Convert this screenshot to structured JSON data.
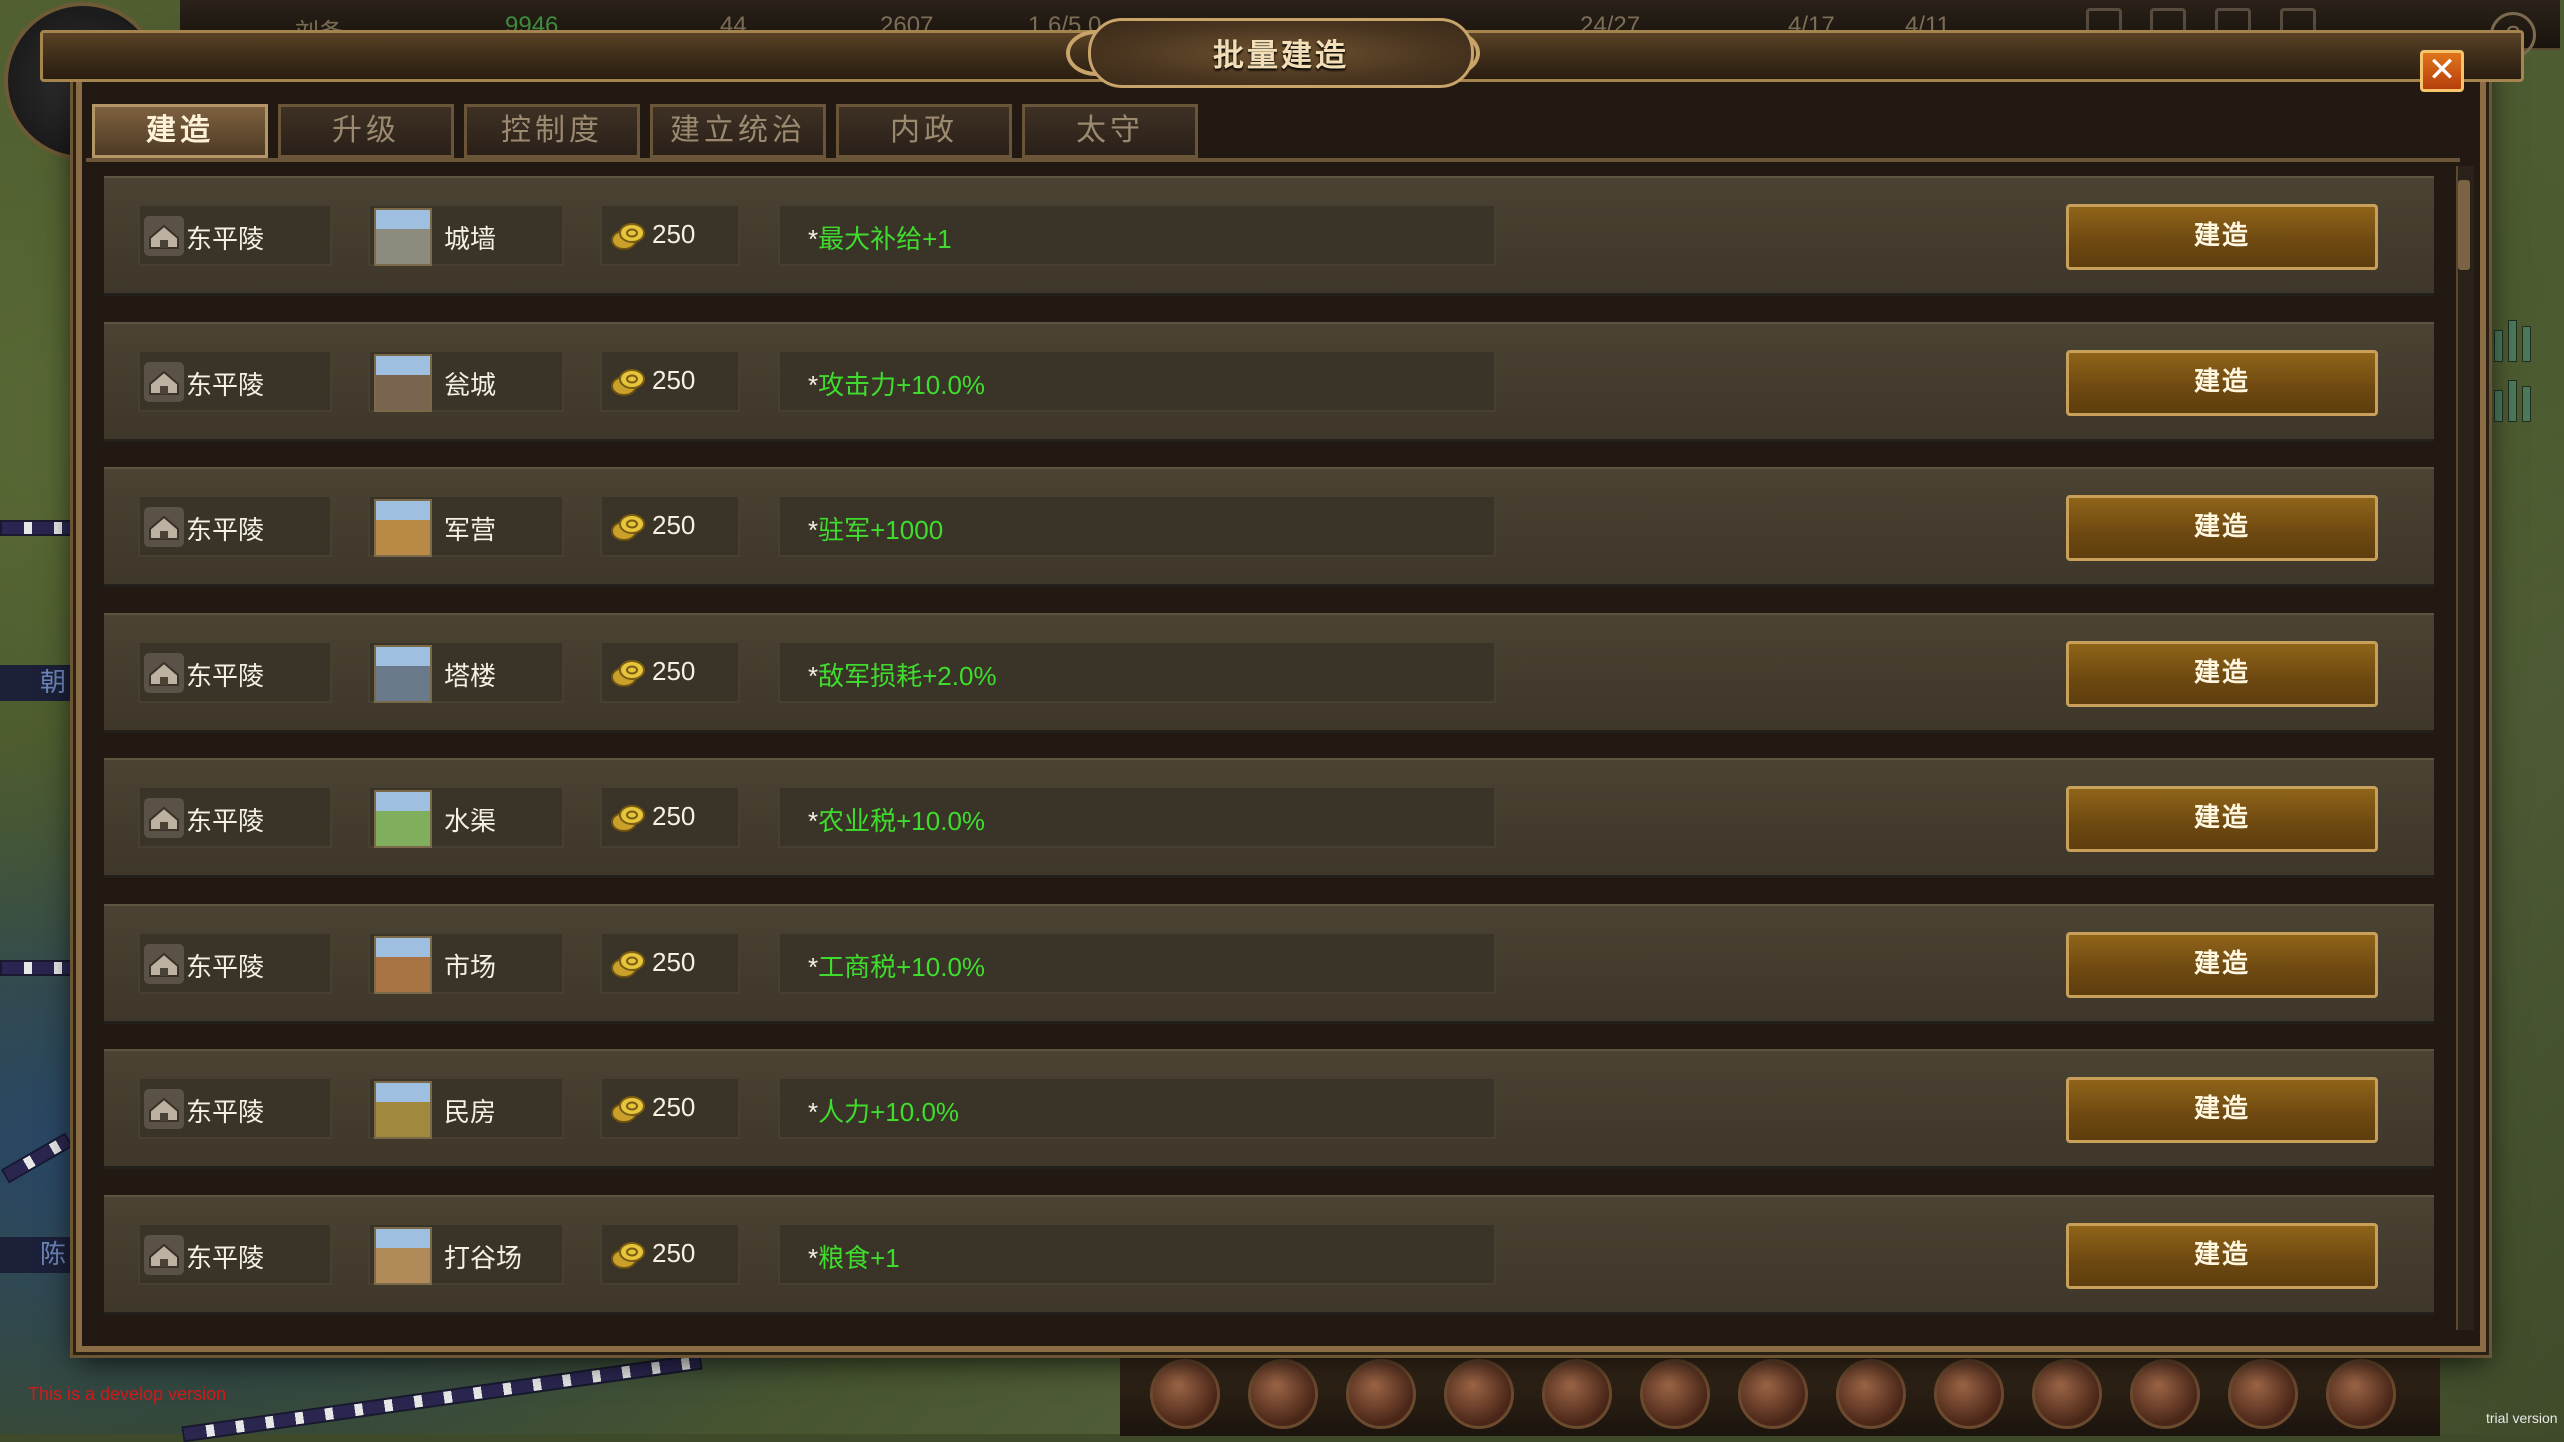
{
  "hud": {
    "resources": [
      "刘备",
      "9946",
      "44",
      "2607",
      "1.6/5.0",
      "24/27",
      "4/17",
      "4/11"
    ],
    "help": "?",
    "side_tags": [
      "朝",
      "陈"
    ],
    "dev_note": "This is a develop version",
    "trial_note": "trial version"
  },
  "dialog": {
    "title": "批量建造",
    "close_symbol": "✕",
    "tabs": [
      "建造",
      "升级",
      "控制度",
      "建立统治",
      "内政",
      "太守"
    ],
    "active_tab": 0,
    "build_label": "建造",
    "rows": [
      {
        "city": "东平陵",
        "building": "城墙",
        "cost": "250",
        "effect": "最大补给+1",
        "building_icon": "wall-icon"
      },
      {
        "city": "东平陵",
        "building": "瓮城",
        "cost": "250",
        "effect": "攻击力+10.0%",
        "building_icon": "barbican-icon"
      },
      {
        "city": "东平陵",
        "building": "军营",
        "cost": "250",
        "effect": "驻军+1000",
        "building_icon": "barracks-icon"
      },
      {
        "city": "东平陵",
        "building": "塔楼",
        "cost": "250",
        "effect": "敌军损耗+2.0%",
        "building_icon": "tower-icon"
      },
      {
        "city": "东平陵",
        "building": "水渠",
        "cost": "250",
        "effect": "农业税+10.0%",
        "building_icon": "canal-icon"
      },
      {
        "city": "东平陵",
        "building": "市场",
        "cost": "250",
        "effect": "工商税+10.0%",
        "building_icon": "market-icon"
      },
      {
        "city": "东平陵",
        "building": "民房",
        "cost": "250",
        "effect": "人力+10.0%",
        "building_icon": "house-icon"
      },
      {
        "city": "东平陵",
        "building": "打谷场",
        "cost": "250",
        "effect": "粮食+1",
        "building_icon": "threshing-floor-icon"
      }
    ]
  },
  "colors": {
    "effect_green": "#3fdc2e",
    "button_gold": "#8f6419",
    "frame_bronze": "#8a6d44"
  }
}
